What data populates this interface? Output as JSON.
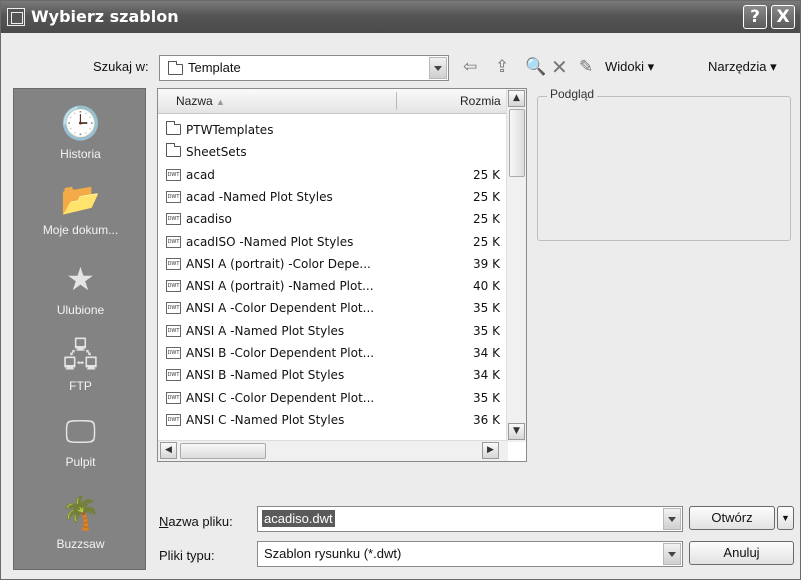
{
  "window": {
    "title": "Wybierz szablon",
    "help_label": "?",
    "close_label": "X"
  },
  "lookin": {
    "label": "Szukaj w:",
    "value": "Template",
    "views_label": "Widoki",
    "tools_label": "Narzędzia"
  },
  "places": [
    {
      "label": "Historia",
      "icon": "history-icon"
    },
    {
      "label": "Moje dokum...",
      "icon": "my-documents-icon"
    },
    {
      "label": "Ulubione",
      "icon": "favorites-icon"
    },
    {
      "label": "FTP",
      "icon": "ftp-icon"
    },
    {
      "label": "Pulpit",
      "icon": "desktop-icon"
    },
    {
      "label": "Buzzsaw",
      "icon": "buzzsaw-icon"
    }
  ],
  "list": {
    "col_name": "Nazwa",
    "col_size": "Rozmia",
    "rows": [
      {
        "name": "PTWTemplates",
        "size": "",
        "type": "folder"
      },
      {
        "name": "SheetSets",
        "size": "",
        "type": "folder"
      },
      {
        "name": "acad",
        "size": "25 K",
        "type": "dwt"
      },
      {
        "name": "acad -Named Plot Styles",
        "size": "25 K",
        "type": "dwt"
      },
      {
        "name": "acadiso",
        "size": "25 K",
        "type": "dwt"
      },
      {
        "name": "acadISO -Named Plot Styles",
        "size": "25 K",
        "type": "dwt"
      },
      {
        "name": "ANSI A (portrait) -Color Depe...",
        "size": "39 K",
        "type": "dwt"
      },
      {
        "name": "ANSI A (portrait) -Named Plot...",
        "size": "40 K",
        "type": "dwt"
      },
      {
        "name": "ANSI A -Color Dependent Plot...",
        "size": "35 K",
        "type": "dwt"
      },
      {
        "name": "ANSI A -Named Plot Styles",
        "size": "35 K",
        "type": "dwt"
      },
      {
        "name": "ANSI B -Color Dependent Plot...",
        "size": "34 K",
        "type": "dwt"
      },
      {
        "name": "ANSI B -Named Plot Styles",
        "size": "34 K",
        "type": "dwt"
      },
      {
        "name": "ANSI C -Color Dependent Plot...",
        "size": "35 K",
        "type": "dwt"
      },
      {
        "name": "ANSI C -Named Plot Styles",
        "size": "36 K",
        "type": "dwt"
      }
    ]
  },
  "preview": {
    "label": "Podgląd"
  },
  "filename": {
    "label": "Nazwa pliku:",
    "value": "acadiso.dwt"
  },
  "filetype": {
    "label": "Pliki typu:",
    "value": "Szablon rysunku (*.dwt)"
  },
  "buttons": {
    "open": "Otwórz",
    "cancel": "Anuluj"
  }
}
